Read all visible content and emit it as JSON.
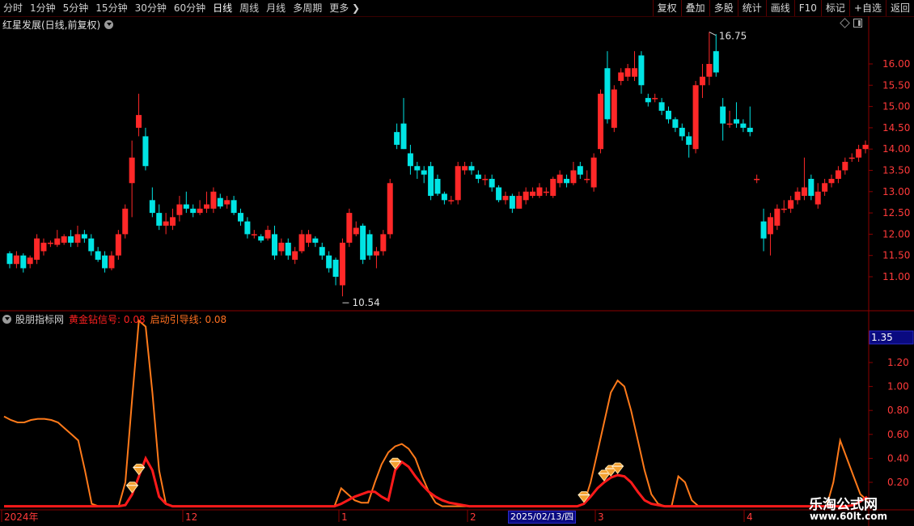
{
  "toolbar": {
    "periods": [
      "分时",
      "1分钟",
      "5分钟",
      "15分钟",
      "30分钟",
      "60分钟",
      "日线",
      "周线",
      "月线",
      "多周期",
      "更多"
    ],
    "active_period": "日线",
    "more_chevron_icon": "chevron-right-icon",
    "right_buttons": [
      "复权",
      "叠加",
      "多股",
      "统计",
      "画线",
      "F10",
      "标记",
      "+自选",
      "返回"
    ]
  },
  "main_title": "红星发展(日线,前复权)",
  "indicator": {
    "name": "股朋指标网",
    "line1_label": "黄金钻信号: 0.08",
    "line2_label": "启动引导线: 0.08"
  },
  "colors": {
    "up": "#ff2828",
    "down": "#00e4e4",
    "line1": "#ff1a1a",
    "line2": "#ff7a1a",
    "axis": "#8b0000",
    "label": "#ff3a3a"
  },
  "annotations": {
    "high_label": "16.75",
    "low_label": "10.54"
  },
  "axis": {
    "price_ticks": [
      "16.00",
      "15.50",
      "15.00",
      "14.50",
      "14.00",
      "13.50",
      "13.00",
      "12.50",
      "12.00",
      "11.50",
      "11.00"
    ],
    "indicator_ticks": [
      "1.20",
      "1.00",
      "0.80",
      "0.60",
      "0.40",
      "0.20"
    ],
    "indicator_current": "1.35",
    "date_labels": [
      "2024年",
      "12",
      "1",
      "2",
      "3",
      "4"
    ],
    "cursor_date": "2025/02/13/四"
  },
  "watermark": {
    "line1": "乐淘公式网",
    "line2": "www.60lt.com"
  },
  "chart_data": [
    {
      "type": "candlestick",
      "title": "红星发展(日线,前复权)",
      "price_range": [
        10.5,
        16.8
      ],
      "candles": [
        [
          11.55,
          11.3,
          11.6,
          11.2
        ],
        [
          11.3,
          11.5,
          11.6,
          11.2
        ],
        [
          11.5,
          11.2,
          11.55,
          11.1
        ],
        [
          11.3,
          11.45,
          11.5,
          11.2
        ],
        [
          11.4,
          11.9,
          12.0,
          11.3
        ],
        [
          11.6,
          11.8,
          11.9,
          11.5
        ],
        [
          11.8,
          11.8,
          11.85,
          11.7
        ],
        [
          11.75,
          11.9,
          12.1,
          11.7
        ],
        [
          11.8,
          11.95,
          12.0,
          11.75
        ],
        [
          11.95,
          11.8,
          12.1,
          11.7
        ],
        [
          11.8,
          12.0,
          12.2,
          11.7
        ],
        [
          12.0,
          11.9,
          12.1,
          11.8
        ],
        [
          11.9,
          11.6,
          12.0,
          11.5
        ],
        [
          11.6,
          11.4,
          11.7,
          11.35
        ],
        [
          11.5,
          11.2,
          11.6,
          11.1
        ],
        [
          11.2,
          11.5,
          11.6,
          11.15
        ],
        [
          11.5,
          12.0,
          12.1,
          11.4
        ],
        [
          12.0,
          12.6,
          12.7,
          11.9
        ],
        [
          13.2,
          13.8,
          14.2,
          12.4
        ],
        [
          14.5,
          14.8,
          15.3,
          14.3
        ],
        [
          14.3,
          13.6,
          14.5,
          13.5
        ],
        [
          12.8,
          12.5,
          13.1,
          12.4
        ],
        [
          12.5,
          12.2,
          12.7,
          12.1
        ],
        [
          12.2,
          12.3,
          12.5,
          12.0
        ],
        [
          12.2,
          12.4,
          12.6,
          12.1
        ],
        [
          12.45,
          12.7,
          12.9,
          12.3
        ],
        [
          12.7,
          12.6,
          13.0,
          12.5
        ],
        [
          12.6,
          12.5,
          12.7,
          12.4
        ],
        [
          12.5,
          12.6,
          12.8,
          12.45
        ],
        [
          12.6,
          12.7,
          13.0,
          12.5
        ],
        [
          12.6,
          13.0,
          13.1,
          12.5
        ],
        [
          12.85,
          12.65,
          12.95,
          12.6
        ],
        [
          12.7,
          12.8,
          12.9,
          12.6
        ],
        [
          12.8,
          12.5,
          12.9,
          12.45
        ],
        [
          12.5,
          12.3,
          12.6,
          12.2
        ],
        [
          12.3,
          12.0,
          12.4,
          11.9
        ],
        [
          12.0,
          12.0,
          12.1,
          11.9
        ],
        [
          11.95,
          11.85,
          12.0,
          11.8
        ],
        [
          11.9,
          12.1,
          12.2,
          11.85
        ],
        [
          12.0,
          11.5,
          12.2,
          11.4
        ],
        [
          11.6,
          11.8,
          11.9,
          11.5
        ],
        [
          11.8,
          11.5,
          11.9,
          11.4
        ],
        [
          11.4,
          11.6,
          11.7,
          11.3
        ],
        [
          11.6,
          12.0,
          12.1,
          11.55
        ],
        [
          11.8,
          12.0,
          12.1,
          11.7
        ],
        [
          11.9,
          11.8,
          11.95,
          11.7
        ],
        [
          11.7,
          11.5,
          11.8,
          11.4
        ],
        [
          11.5,
          11.2,
          11.6,
          11.1
        ],
        [
          11.4,
          11.0,
          11.45,
          10.8
        ],
        [
          10.8,
          11.8,
          11.9,
          10.54
        ],
        [
          11.8,
          12.5,
          12.6,
          11.7
        ],
        [
          12.0,
          12.15,
          12.3,
          11.95
        ],
        [
          12.2,
          11.4,
          12.25,
          11.3
        ],
        [
          12.0,
          11.5,
          12.1,
          11.4
        ],
        [
          11.5,
          11.6,
          11.7,
          11.2
        ],
        [
          11.6,
          12.0,
          12.1,
          11.5
        ],
        [
          12.0,
          13.2,
          13.3,
          11.9
        ],
        [
          14.4,
          14.1,
          14.6,
          14.0
        ],
        [
          14.6,
          14.0,
          15.2,
          14.0
        ],
        [
          13.9,
          13.6,
          14.1,
          13.4
        ],
        [
          13.6,
          13.5,
          13.7,
          13.3
        ],
        [
          13.5,
          13.4,
          13.6,
          13.2
        ],
        [
          13.6,
          12.9,
          13.7,
          12.8
        ],
        [
          13.3,
          12.95,
          13.4,
          12.9
        ],
        [
          12.95,
          12.8,
          13.0,
          12.7
        ],
        [
          12.8,
          12.8,
          12.9,
          12.7
        ],
        [
          12.8,
          13.6,
          13.7,
          12.7
        ],
        [
          13.5,
          13.6,
          13.7,
          13.4
        ],
        [
          13.6,
          13.5,
          13.7,
          13.4
        ],
        [
          13.4,
          13.3,
          13.5,
          13.2
        ],
        [
          13.3,
          13.3,
          13.4,
          13.15
        ],
        [
          13.3,
          13.1,
          13.4,
          13.0
        ],
        [
          13.1,
          12.8,
          13.15,
          12.75
        ],
        [
          12.8,
          12.9,
          13.0,
          12.7
        ],
        [
          12.9,
          12.6,
          12.95,
          12.5
        ],
        [
          12.6,
          12.9,
          13.0,
          12.6
        ],
        [
          12.8,
          13.0,
          13.1,
          12.7
        ],
        [
          12.9,
          13.0,
          13.1,
          12.85
        ],
        [
          12.9,
          13.1,
          13.2,
          12.85
        ],
        [
          13.0,
          13.0,
          13.1,
          12.9
        ],
        [
          12.9,
          13.3,
          13.35,
          12.85
        ],
        [
          13.2,
          13.4,
          13.5,
          13.1
        ],
        [
          13.3,
          13.2,
          13.4,
          13.1
        ],
        [
          13.2,
          13.5,
          13.7,
          13.15
        ],
        [
          13.6,
          13.4,
          13.7,
          13.3
        ],
        [
          13.3,
          13.3,
          13.5,
          13.2
        ],
        [
          13.1,
          13.8,
          13.9,
          13.0
        ],
        [
          14.0,
          15.3,
          15.4,
          13.9
        ],
        [
          15.9,
          14.7,
          16.3,
          14.6
        ],
        [
          14.5,
          15.4,
          15.5,
          14.4
        ],
        [
          15.6,
          15.8,
          15.9,
          15.5
        ],
        [
          15.7,
          15.9,
          16.0,
          15.6
        ],
        [
          15.7,
          15.9,
          16.3,
          15.6
        ],
        [
          16.2,
          15.5,
          16.3,
          15.3
        ],
        [
          15.2,
          15.1,
          15.3,
          15.0
        ],
        [
          15.2,
          15.2,
          15.3,
          15.1
        ],
        [
          15.1,
          14.9,
          15.2,
          14.8
        ],
        [
          14.9,
          14.7,
          15.0,
          14.6
        ],
        [
          14.7,
          14.5,
          14.75,
          14.4
        ],
        [
          14.5,
          14.3,
          14.6,
          14.2
        ],
        [
          14.3,
          14.1,
          14.4,
          13.8
        ],
        [
          14.0,
          15.5,
          15.6,
          13.9
        ],
        [
          15.5,
          15.7,
          16.0,
          15.2
        ],
        [
          15.7,
          16.0,
          16.75,
          15.5
        ],
        [
          16.3,
          15.8,
          16.7,
          15.7
        ],
        [
          15.0,
          14.6,
          15.2,
          14.2
        ],
        [
          14.6,
          14.6,
          14.9,
          14.5
        ],
        [
          14.7,
          14.6,
          15.1,
          14.5
        ],
        [
          14.6,
          14.5,
          14.7,
          14.4
        ],
        [
          14.5,
          14.4,
          15.0,
          14.3
        ],
        [
          13.3,
          13.3,
          13.4,
          13.2
        ],
        [
          12.3,
          11.9,
          12.6,
          11.6
        ],
        [
          12.0,
          12.4,
          12.5,
          11.5
        ],
        [
          12.2,
          12.6,
          12.7,
          12.1
        ],
        [
          12.6,
          12.6,
          12.8,
          12.5
        ],
        [
          12.6,
          12.8,
          12.9,
          12.5
        ],
        [
          12.8,
          13.0,
          13.1,
          12.7
        ],
        [
          12.9,
          13.1,
          13.8,
          12.8
        ],
        [
          13.3,
          12.9,
          13.4,
          12.8
        ],
        [
          12.7,
          13.0,
          13.2,
          12.6
        ],
        [
          13.0,
          13.2,
          13.3,
          12.9
        ],
        [
          13.2,
          13.3,
          13.4,
          13.1
        ],
        [
          13.3,
          13.5,
          13.6,
          13.2
        ],
        [
          13.5,
          13.7,
          13.8,
          13.4
        ],
        [
          13.8,
          13.8,
          13.9,
          13.7
        ],
        [
          13.8,
          14.0,
          14.1,
          13.7
        ],
        [
          14.0,
          14.1,
          14.2,
          13.9
        ]
      ]
    },
    {
      "type": "line",
      "title": "股朋指标网",
      "ylim": [
        0,
        1.35
      ],
      "series": [
        {
          "name": "黄金钻信号",
          "values": [
            0,
            0,
            0,
            0,
            0,
            0,
            0,
            0,
            0,
            0,
            0,
            0,
            0,
            0,
            0,
            0,
            0,
            0,
            0.01,
            0.1,
            0.25,
            0.4,
            0.3,
            0.08,
            0.02,
            0,
            0,
            0,
            0,
            0,
            0,
            0,
            0,
            0,
            0,
            0,
            0,
            0,
            0,
            0,
            0,
            0,
            0,
            0,
            0,
            0,
            0,
            0,
            0,
            0,
            0.02,
            0.05,
            0.08,
            0.1,
            0.12,
            0.12,
            0.08,
            0.05,
            0.3,
            0.37,
            0.33,
            0.25,
            0.18,
            0.12,
            0.08,
            0.05,
            0.03,
            0.02,
            0.01,
            0,
            0,
            0,
            0,
            0,
            0,
            0,
            0,
            0,
            0,
            0,
            0,
            0,
            0,
            0,
            0,
            0,
            0.02,
            0.08,
            0.15,
            0.2,
            0.24,
            0.26,
            0.25,
            0.2,
            0.12,
            0.05,
            0.02,
            0.01,
            0,
            0,
            0,
            0,
            0,
            0,
            0,
            0,
            0,
            0,
            0,
            0,
            0,
            0,
            0,
            0,
            0,
            0,
            0,
            0,
            0,
            0,
            0,
            0,
            0,
            0,
            0,
            0,
            0.01,
            0.04,
            0.08
          ]
        },
        {
          "name": "启动引导线",
          "values": [
            0.75,
            0.72,
            0.7,
            0.7,
            0.72,
            0.73,
            0.73,
            0.72,
            0.7,
            0.65,
            0.6,
            0.55,
            0.3,
            0.02,
            0,
            0,
            0,
            0,
            0.2,
            0.9,
            1.55,
            1.5,
            0.95,
            0.3,
            0.02,
            0,
            0,
            0,
            0,
            0,
            0,
            0,
            0,
            0,
            0,
            0,
            0,
            0,
            0,
            0,
            0,
            0,
            0,
            0,
            0,
            0,
            0,
            0,
            0,
            0,
            0.15,
            0.1,
            0.05,
            0.03,
            0.03,
            0.2,
            0.35,
            0.45,
            0.5,
            0.52,
            0.48,
            0.4,
            0.25,
            0.12,
            0.03,
            0,
            0,
            0,
            0,
            0,
            0,
            0,
            0,
            0,
            0,
            0,
            0,
            0,
            0,
            0,
            0,
            0,
            0,
            0,
            0,
            0,
            0.02,
            0.2,
            0.45,
            0.7,
            0.95,
            1.05,
            1.0,
            0.8,
            0.55,
            0.3,
            0.1,
            0.02,
            0,
            0,
            0.25,
            0.2,
            0.05,
            0,
            0,
            0,
            0,
            0,
            0,
            0,
            0,
            0,
            0,
            0,
            0,
            0,
            0,
            0,
            0,
            0,
            0,
            0,
            0,
            0.2,
            0.55,
            0.4,
            0.25,
            0.1,
            0.05
          ]
        }
      ],
      "signal_markers_at": [
        19,
        20,
        58,
        86,
        89,
        90,
        91
      ]
    }
  ]
}
